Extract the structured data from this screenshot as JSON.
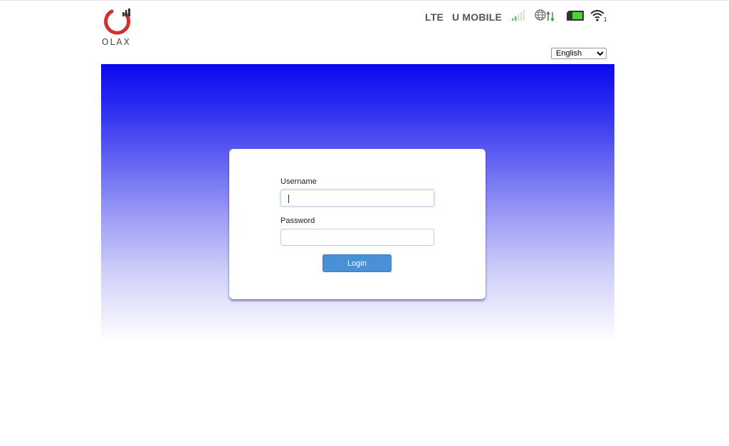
{
  "brand": {
    "name": "OLAX",
    "logo_color": "#d32f2f"
  },
  "status_bar": {
    "network_type": "LTE",
    "operator": "U MOBILE",
    "signal_icon": "signal-bars-icon",
    "signal_level": "2 of 5 bars",
    "internet_icon": "globe-data-icon",
    "battery_icon": "battery-icon",
    "battery_color": "#4cd137",
    "wifi_icon": "wifi-icon",
    "wifi_clients": "1"
  },
  "language": {
    "selected": "English"
  },
  "login": {
    "username_label": "Username",
    "username_value": "",
    "password_label": "Password",
    "password_value": "",
    "login_button": "Login",
    "banner_color": "#0909ee",
    "button_color": "#4a90d6"
  }
}
